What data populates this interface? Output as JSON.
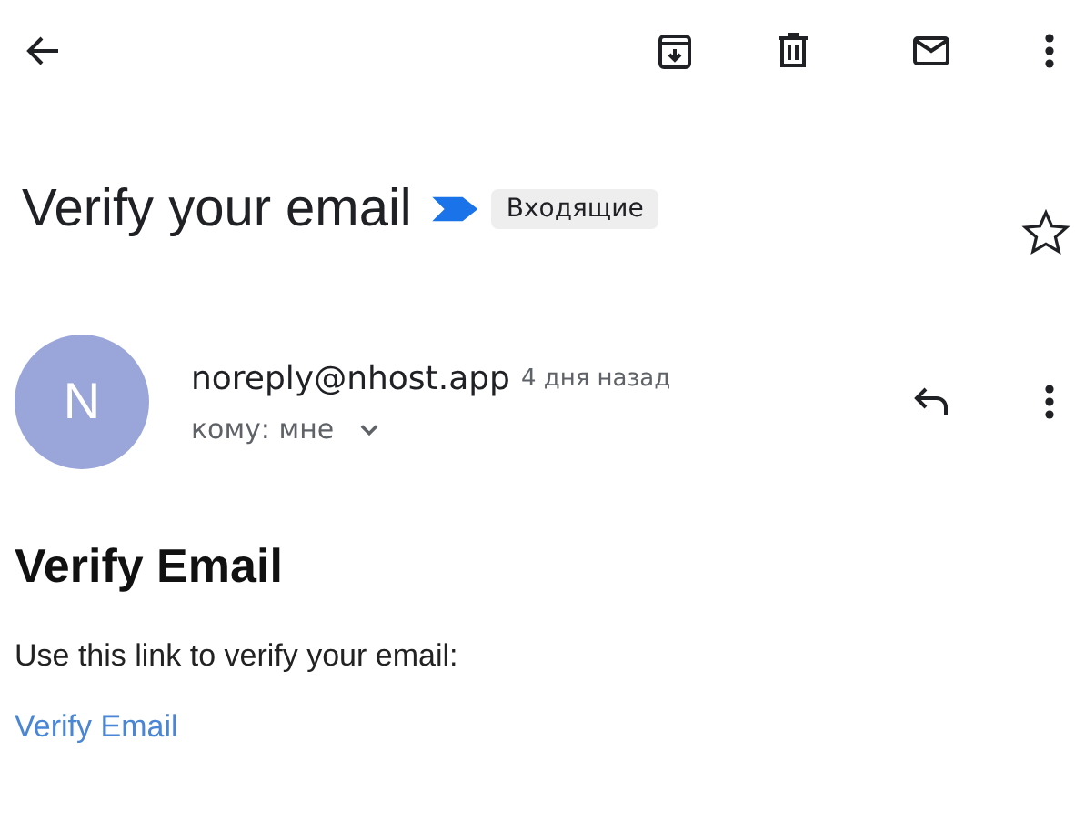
{
  "subject": {
    "title": "Verify your email",
    "label": "Входящие",
    "important": true,
    "starred": false
  },
  "message": {
    "avatar_letter": "N",
    "sender": "noreply@nhost.app",
    "time": "4 дня назад",
    "recipient": "кому: мне"
  },
  "body": {
    "heading": "Verify Email",
    "text": "Use this link to verify your email:",
    "link": "Verify Email"
  }
}
